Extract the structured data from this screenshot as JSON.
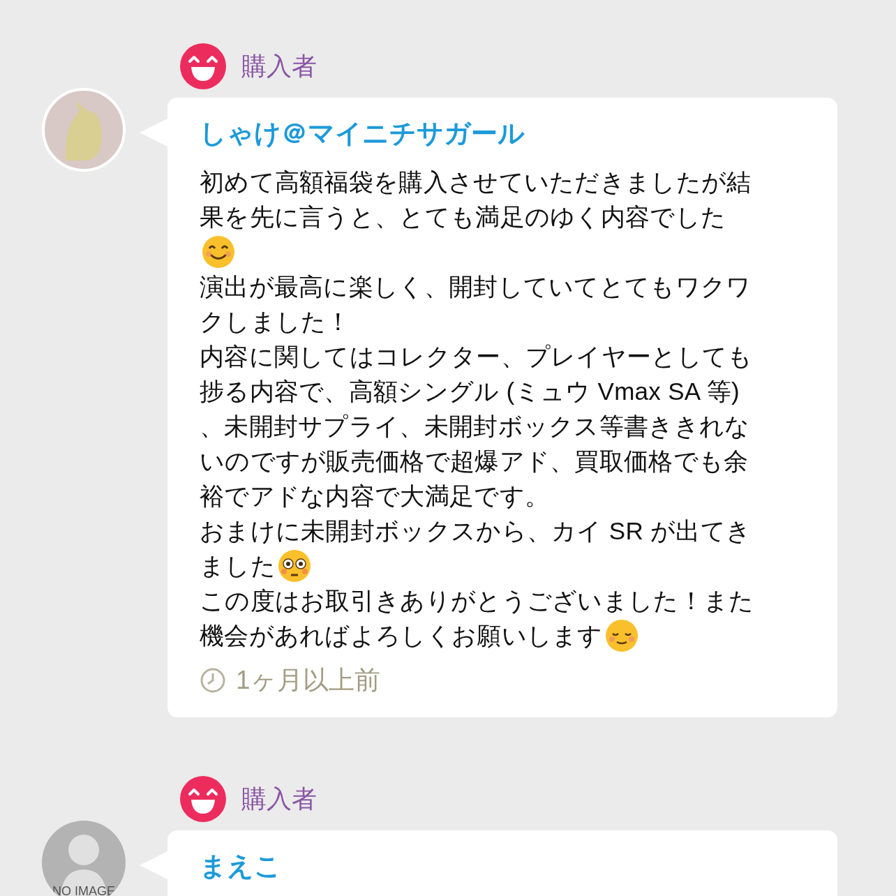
{
  "reviews": [
    {
      "role": "購入者",
      "avatar": {
        "kind": "photo"
      },
      "name": "しゃけ＠マイニチサガール",
      "lines": [
        {
          "kind": "text",
          "text": "初めて高額福袋を購入させていただきましたが結"
        },
        {
          "kind": "text",
          "text": "果を先に言うと、とても満足のゆく内容でした"
        },
        {
          "kind": "smile"
        },
        {
          "kind": "text",
          "text": "演出が最高に楽しく、開封していてとてもワクワ"
        },
        {
          "kind": "text",
          "text": "クしました！"
        },
        {
          "kind": "text",
          "text": "内容に関してはコレクター、プレイヤーとしても"
        },
        {
          "kind": "text",
          "text": "捗る内容で、高額シングル (ミュウ Vmax SA 等)"
        },
        {
          "kind": "text",
          "text": "、未開封サプライ、未開封ボックス等書ききれな"
        },
        {
          "kind": "text",
          "text": "いのですが販売価格で超爆アド、買取価格でも余"
        },
        {
          "kind": "text",
          "text": "裕でアドな内容で大満足です。"
        },
        {
          "kind": "text",
          "text": "おまけに未開封ボックスから、カイ SR が出てき"
        },
        {
          "kind": "flushed",
          "text": "ました"
        },
        {
          "kind": "text",
          "text": "この度はお取引きありがとうございました！また"
        },
        {
          "kind": "relaxed",
          "text": "機会があればよろしくお願いします"
        }
      ],
      "time": "1ヶ月以上前"
    },
    {
      "role": "購入者",
      "avatar": {
        "kind": "none",
        "label": "NO IMAGE"
      },
      "name": "まえこ"
    }
  ]
}
